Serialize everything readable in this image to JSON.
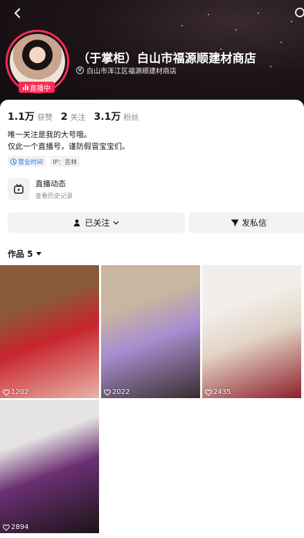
{
  "header": {
    "shop_name": "（于掌柜）白山市福源顺建材商店",
    "verified_label": "白山市浑江区福源顺建材商店",
    "live_badge": "直播中"
  },
  "stats": [
    {
      "num": "1.1万",
      "label": "获赞"
    },
    {
      "num": "2",
      "label": "关注"
    },
    {
      "num": "3.1万",
      "label": "粉丝"
    }
  ],
  "bio": {
    "line1": "唯一关注是我的大号哦。",
    "line2": "仅此一个直播号，谨防假冒宝宝们。"
  },
  "tags": {
    "hours": "营业时间",
    "ip": "IP：吉林"
  },
  "live_feed": {
    "title": "直播动态",
    "subtitle": "查看历史记录"
  },
  "actions": {
    "follow_label": "已关注",
    "dm_label": "发私信"
  },
  "works": {
    "title": "作品 5",
    "items": [
      {
        "likes": "1202",
        "palette": [
          "#8a5a3a",
          "#c8242e",
          "#e8b3a8"
        ]
      },
      {
        "likes": "2022",
        "palette": [
          "#c9b6a0",
          "#a98ed0",
          "#3a2c2c"
        ]
      },
      {
        "likes": "2435",
        "palette": [
          "#f2eeea",
          "#e3d5c6",
          "#8d1f2a"
        ]
      },
      {
        "likes": "2894",
        "palette": [
          "#e6e4e3",
          "#6b2f73",
          "#1a1517"
        ]
      }
    ]
  },
  "colors": {
    "accent": "#fe2c55",
    "text": "#161823",
    "muted": "#8a8b91",
    "chip_bg": "#f2f2f4"
  }
}
